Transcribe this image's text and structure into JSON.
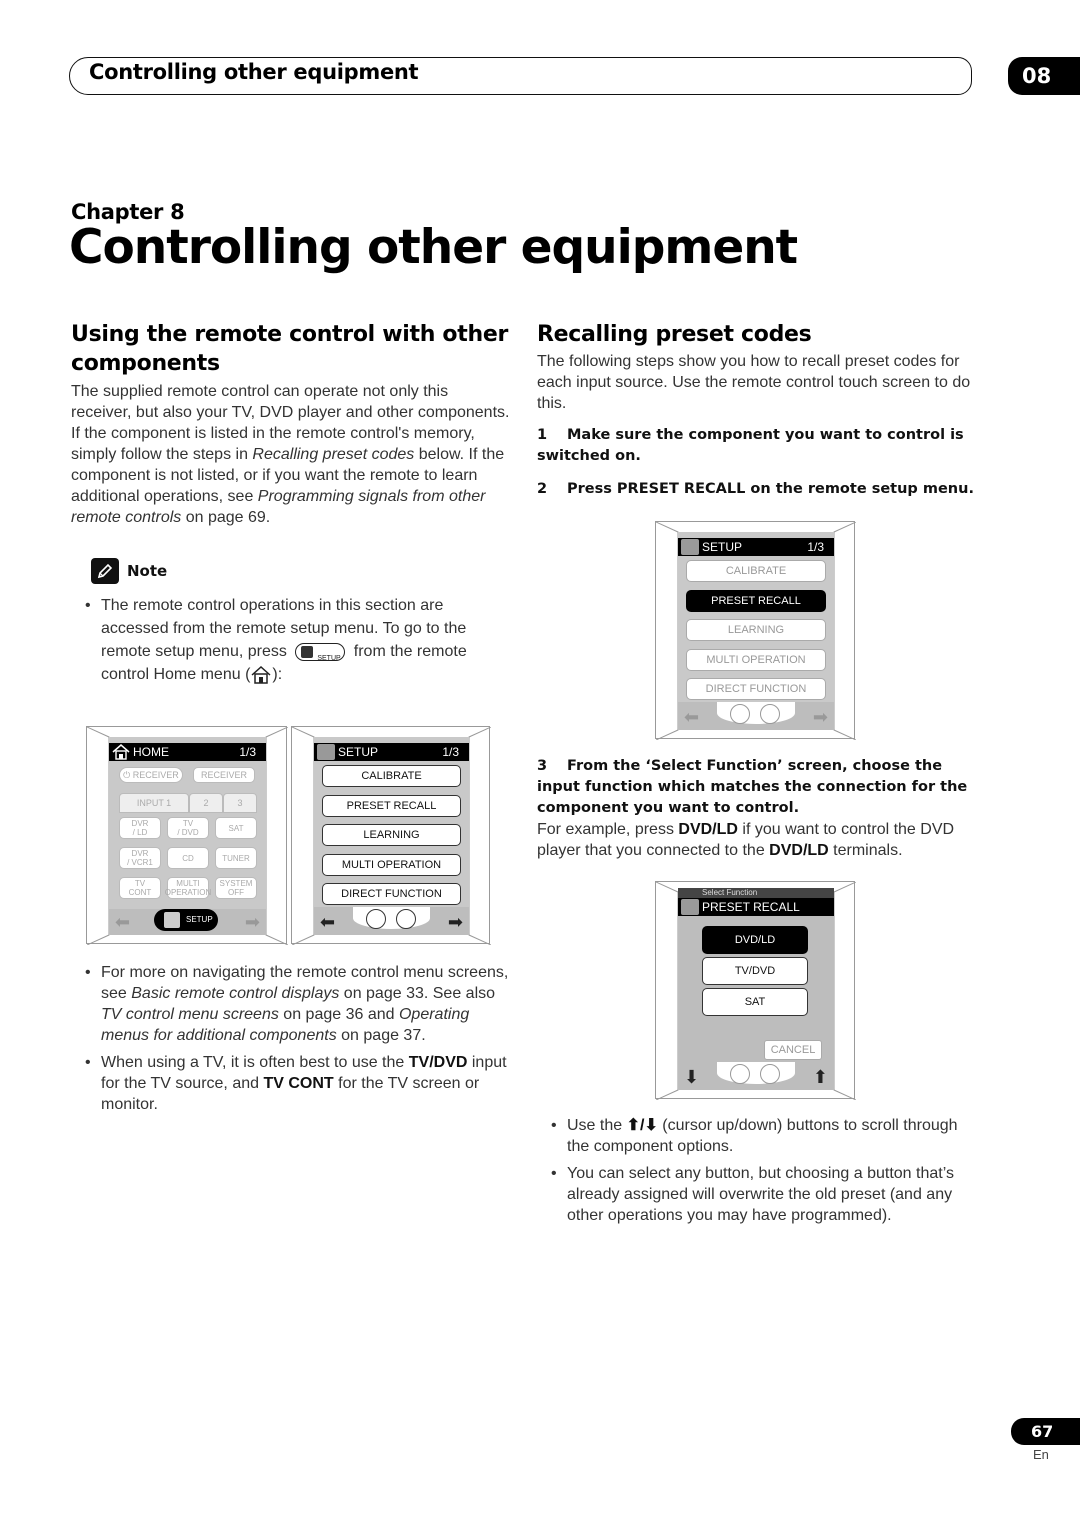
{
  "header": {
    "running_title": "Controlling other equipment",
    "chapter_badge": "08"
  },
  "chapter": {
    "label": "Chapter 8",
    "title": "Controlling other equipment"
  },
  "left": {
    "heading": "Using the remote control with other components",
    "intro_parts": [
      "The supplied remote control can operate not only this receiver, but also your TV, DVD player and other components. If the component is listed in the remote control's memory, simply follow the steps in ",
      "Recalling preset codes",
      " below. If the component is not listed, or if you want the remote to learn additional operations, see ",
      "Programming signals from other remote controls",
      " on page 69."
    ],
    "note": {
      "label": "Note",
      "bullet1_a": "The remote control operations in this section are accessed from the remote setup menu. To go to the remote setup menu, press",
      "bullet1_setup_icon_text": "SETUP",
      "bullet1_b": "from the remote control Home menu (",
      "bullet1_c": "):"
    },
    "bullets": [
      {
        "parts": [
          "For more on navigating the remote control menu screens, see ",
          "Basic remote control displays",
          " on page 33. See also ",
          "TV control menu screens",
          " on page 36 and ",
          "Operating menus for additional components",
          " on page 37."
        ]
      },
      {
        "parts": [
          "When using a TV, it is often best to use the ",
          "TV/DVD",
          " input for the TV source, and ",
          "TV CONT",
          " for the TV screen or monitor."
        ]
      }
    ]
  },
  "remote_home": {
    "title": "HOME",
    "page": "1/3",
    "receiver_power": "RECEIVER",
    "receiver_panel": "RECEIVER",
    "tabs": [
      "INPUT 1",
      "2",
      "3"
    ],
    "grid": [
      [
        "DVR\n/ LD",
        "TV\n/ DVD",
        "SAT"
      ],
      [
        "DVR\n/ VCR1",
        "CD",
        "TUNER"
      ],
      [
        "TV\nCONT",
        "MULTI\nOPERATION",
        "SYSTEM\nOFF"
      ]
    ],
    "setup_button": "SETUP"
  },
  "remote_setup": {
    "title": "SETUP",
    "page": "1/3",
    "items": [
      "CALIBRATE",
      "PRESET RECALL",
      "LEARNING",
      "MULTI OPERATION",
      "DIRECT FUNCTION"
    ]
  },
  "right": {
    "heading": "Recalling preset codes",
    "intro": "The following steps show you how to recall preset codes for each input source. Use the remote control touch screen to do this.",
    "step1_num": "1",
    "step1": "Make sure the component you want to control is switched on.",
    "step2_num": "2",
    "step2": "Press PRESET RECALL on the remote setup menu.",
    "step3_num": "3",
    "step3": "From the ‘Select Function’ screen, choose the input function which matches the connection for the component you want to control.",
    "step3_body_parts": [
      "For example, press ",
      "DVD/LD",
      " if you want to control the DVD player that you connected to the ",
      "DVD/LD",
      " terminals."
    ],
    "bullets": [
      [
        "Use the ",
        "⬆/⬇",
        " (cursor up/down) buttons to scroll through the component options."
      ],
      [
        "You can select any button, but choosing a button that’s already assigned will overwrite the old preset (and any other operations you may have programmed)."
      ]
    ]
  },
  "remote_setup_selected": {
    "title": "SETUP",
    "page": "1/3",
    "items": [
      "CALIBRATE",
      "PRESET RECALL",
      "LEARNING",
      "MULTI OPERATION",
      "DIRECT FUNCTION"
    ],
    "selected_index": 1
  },
  "remote_select_function": {
    "subtitle": "Select Function",
    "title": "PRESET RECALL",
    "items": [
      "DVD/LD",
      "TV/DVD",
      "SAT"
    ],
    "selected_index": 0,
    "cancel": "CANCEL"
  },
  "footer": {
    "page_number": "67",
    "language": "En"
  }
}
